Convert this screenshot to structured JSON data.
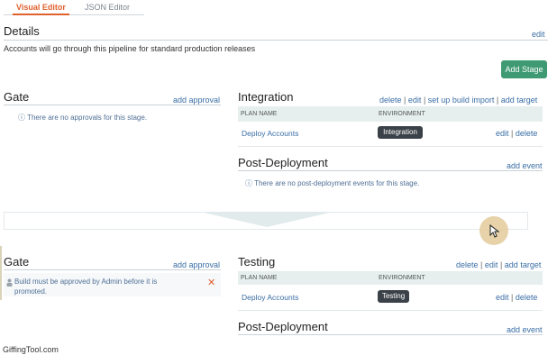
{
  "tabs": {
    "visual": "Visual Editor",
    "json": "JSON Editor"
  },
  "details": {
    "title": "Details",
    "edit": "edit",
    "description": "Accounts will go through this pipeline for standard production releases"
  },
  "add_stage": "Add Stage",
  "stage1": {
    "gate_title": "Gate",
    "add_approval": "add approval",
    "no_approvals": "There are no approvals for this stage.",
    "name": "Integration",
    "actions": {
      "delete": "delete",
      "edit": "edit",
      "build_import": "set up build import",
      "add_target": "add target",
      "sep": "|"
    },
    "table_headers": {
      "plan": "PLAN NAME",
      "env": "ENVIRONMENT"
    },
    "row": {
      "plan": "Deploy Accounts",
      "env": "Integration",
      "edit": "edit",
      "delete": "delete",
      "sep": "|"
    },
    "post_title": "Post-Deployment",
    "add_event": "add event",
    "no_events": "There are no post-deployment events for this stage."
  },
  "stage2": {
    "gate_title": "Gate",
    "add_approval": "add approval",
    "approval_text": "Build must be approved by Admin before it is promoted.",
    "remove_icon": "close-icon",
    "name": "Testing",
    "actions": {
      "delete": "delete",
      "edit": "edit",
      "add_target": "add target",
      "sep": "|"
    },
    "table_headers": {
      "plan": "PLAN NAME",
      "env": "ENVIRONMENT"
    },
    "row": {
      "plan": "Deploy Accounts",
      "env": "Testing",
      "edit": "edit",
      "delete": "delete",
      "sep": "|"
    },
    "post_title": "Post-Deployment",
    "add_event": "add event"
  },
  "watermark": "GiffingTool.com",
  "colors": {
    "accent_tab": "#e0602e",
    "button_green": "#3f9a73",
    "link": "#3a6ea5",
    "pill_dark": "#3b4148"
  }
}
